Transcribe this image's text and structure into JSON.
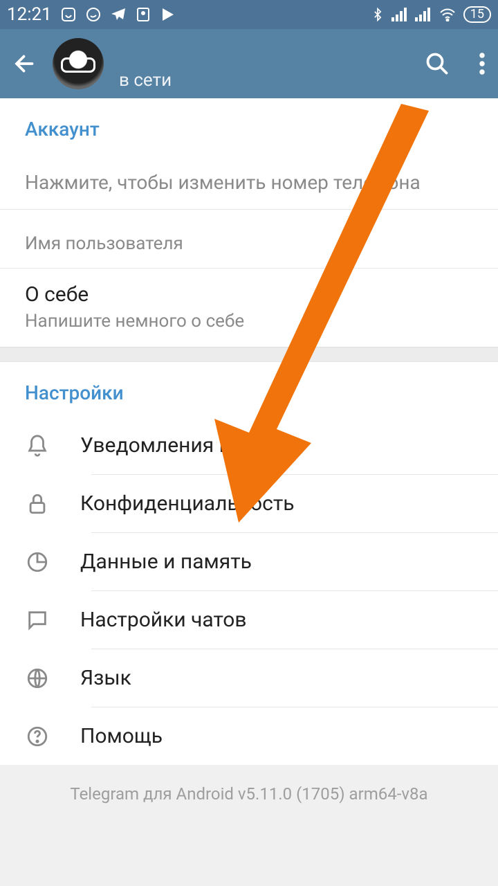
{
  "status_bar": {
    "time": "12:21",
    "battery": "15"
  },
  "header": {
    "status": "в сети"
  },
  "sections": {
    "account": {
      "title": "Аккаунт",
      "phone_hint": "Нажмите, чтобы изменить номер телефона",
      "username_label": "Имя пользователя",
      "bio_label": "О себе",
      "bio_hint": "Напишите немного о себе"
    },
    "settings": {
      "title": "Настройки",
      "items": [
        {
          "label": "Уведомления и звук"
        },
        {
          "label": "Конфиденциальность"
        },
        {
          "label": "Данные и память"
        },
        {
          "label": "Настройки чатов"
        },
        {
          "label": "Язык"
        },
        {
          "label": "Помощь"
        }
      ]
    }
  },
  "footer": "Telegram для Android v5.11.0 (1705) arm64-v8a",
  "colors": {
    "accent": "#5682a3",
    "link": "#4390cf",
    "arrow": "#f0730b"
  }
}
